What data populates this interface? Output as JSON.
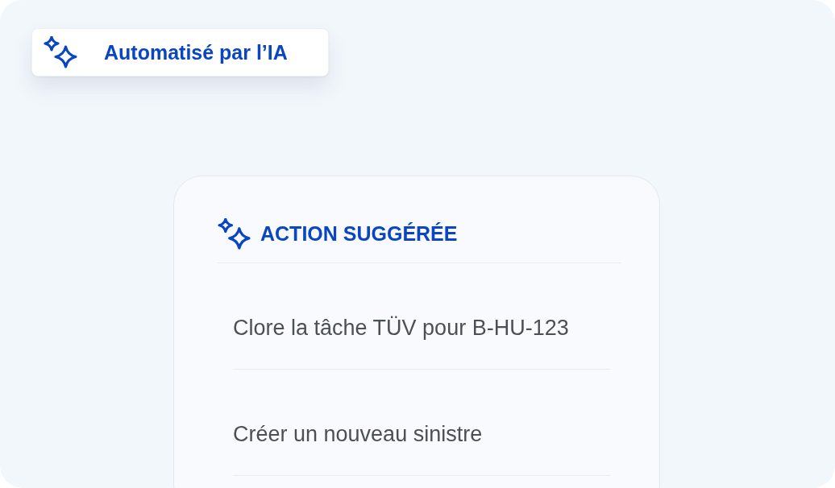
{
  "badge": {
    "label": "Automatisé par l’IA"
  },
  "card": {
    "title": "ACTION SUGGÉRÉE",
    "actions": [
      {
        "label": "Clore la tâche TÜV pour B-HU-123"
      },
      {
        "label": "Créer un nouveau sinistre"
      }
    ]
  }
}
